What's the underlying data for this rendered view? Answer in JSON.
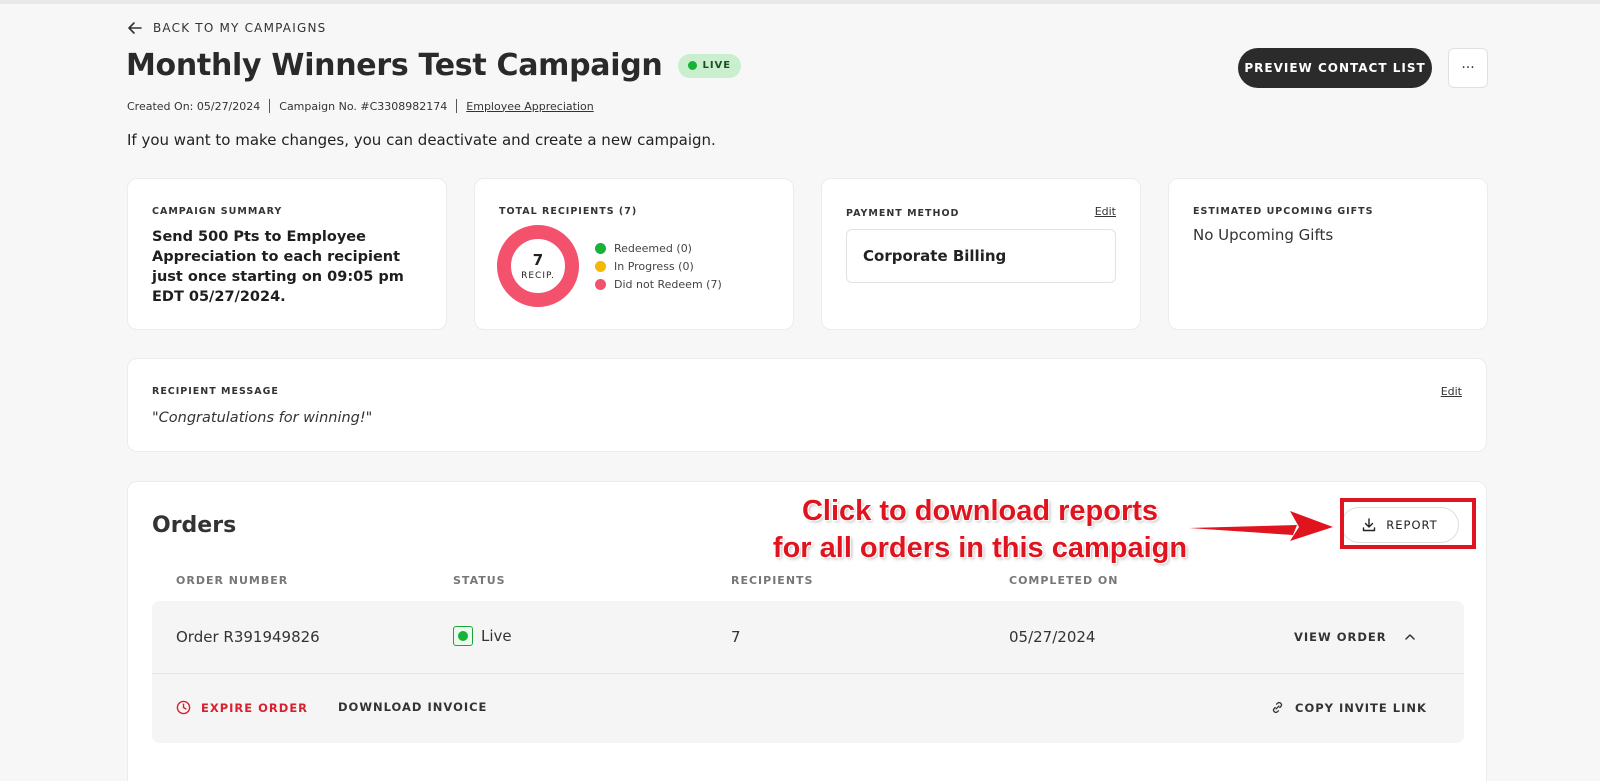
{
  "nav": {
    "back_label": "BACK TO MY CAMPAIGNS"
  },
  "campaign": {
    "title": "Monthly Winners Test Campaign",
    "status_label": "LIVE",
    "created_on": "Created On: 05/27/2024",
    "campaign_no": "Campaign No. #C3308982174",
    "category": "Employee Appreciation",
    "info_text": "If you want to make changes, you can deactivate and create a new campaign."
  },
  "header_actions": {
    "preview_label": "PREVIEW CONTACT LIST",
    "more_label": "···"
  },
  "summary": {
    "label": "CAMPAIGN SUMMARY",
    "text": "Send 500 Pts to Employee Appreciation to each recipient just once starting on 09:05 pm EDT 05/27/2024."
  },
  "recipients": {
    "label": "TOTAL RECIPIENTS (7)",
    "total": "7",
    "unit": "RECIP.",
    "legend": [
      {
        "label": "Redeemed (0)",
        "color": "#16b336",
        "count": 0
      },
      {
        "label": "In Progress (0)",
        "color": "#f5b800",
        "count": 0
      },
      {
        "label": "Did not Redeem (7)",
        "color": "#f4516c",
        "count": 7
      }
    ]
  },
  "payment": {
    "label": "PAYMENT METHOD",
    "edit_label": "Edit",
    "method": "Corporate Billing"
  },
  "upcoming": {
    "label": "ESTIMATED UPCOMING GIFTS",
    "text": "No Upcoming Gifts"
  },
  "message": {
    "label": "RECIPIENT MESSAGE",
    "edit_label": "Edit",
    "text": "\"Congratulations for winning!\""
  },
  "orders": {
    "title": "Orders",
    "report_label": "REPORT",
    "columns": [
      "ORDER NUMBER",
      "STATUS",
      "RECIPIENTS",
      "COMPLETED ON"
    ],
    "rows": [
      {
        "order_number": "Order R391949826",
        "status": "Live",
        "recipients": "7",
        "completed_on": "05/27/2024",
        "view_label": "VIEW ORDER"
      }
    ],
    "actions": {
      "expire_label": "EXPIRE ORDER",
      "invoice_label": "DOWNLOAD INVOICE",
      "invite_label": "COPY INVITE LINK"
    }
  },
  "annotation": {
    "line1": "Click to download reports",
    "line2": "for all orders in this campaign",
    "color": "#e0141e"
  },
  "colors": {
    "live_green": "#16b336",
    "expire_red": "#d8202e",
    "dark_button": "#2b2b2b"
  }
}
